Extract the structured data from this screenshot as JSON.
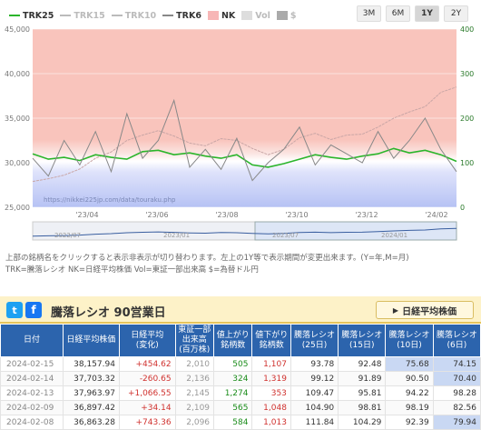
{
  "legend": {
    "items": [
      {
        "label": "TRK25",
        "color": "#2bb52b",
        "style": "line",
        "active": true
      },
      {
        "label": "TRK15",
        "color": "#bbbbbb",
        "style": "line",
        "active": false
      },
      {
        "label": "TRK10",
        "color": "#bbbbbb",
        "style": "line",
        "active": false
      },
      {
        "label": "TRK6",
        "color": "#888888",
        "style": "line",
        "active": true
      },
      {
        "label": "NK",
        "color": "#f7b6b6",
        "style": "box",
        "active": true
      },
      {
        "label": "Vol",
        "color": "#dddddd",
        "style": "box",
        "active": false
      },
      {
        "label": "$",
        "color": "#aaaaaa",
        "style": "box",
        "active": false
      }
    ]
  },
  "period_buttons": [
    {
      "label": "3M",
      "active": false
    },
    {
      "label": "6M",
      "active": false
    },
    {
      "label": "1Y",
      "active": true
    },
    {
      "label": "2Y",
      "active": false
    }
  ],
  "chart_data": {
    "type": "line",
    "left_axis": {
      "ticks": [
        "45,000",
        "40,000",
        "35,000",
        "30,000",
        "25,000"
      ],
      "range": [
        25000,
        45000
      ]
    },
    "right_axis": {
      "ticks": [
        "400",
        "300",
        "200",
        "100",
        "0"
      ],
      "range": [
        0,
        400
      ]
    },
    "x_ticks": [
      "'23/04",
      "'23/06",
      "'23/08",
      "'23/10",
      "'23/12",
      "'24/02"
    ],
    "watermark": "https://nikkei225jp.com/data/touraku.php",
    "navigator_labels": [
      "2022/07",
      "2023/01",
      "2023/07",
      "2024/01"
    ],
    "series": [
      {
        "name": "NK",
        "color": "#f7b6b6",
        "values": [
          27900,
          28200,
          28600,
          29300,
          30500,
          31200,
          32500,
          33100,
          33600,
          33000,
          32200,
          31900,
          32700,
          32500,
          31600,
          30900,
          31500,
          32800,
          33300,
          32600,
          33100,
          33200,
          34000,
          35000,
          35700,
          36300,
          37900,
          38500
        ]
      },
      {
        "name": "TRK25",
        "color": "#2bb52b",
        "values": [
          120,
          108,
          112,
          105,
          118,
          112,
          108,
          125,
          128,
          118,
          122,
          115,
          110,
          118,
          95,
          90,
          98,
          108,
          118,
          112,
          108,
          115,
          120,
          132,
          122,
          128,
          118,
          103
        ]
      },
      {
        "name": "TRK6",
        "color": "#888888",
        "values": [
          110,
          70,
          150,
          95,
          170,
          80,
          210,
          110,
          150,
          240,
          90,
          130,
          85,
          155,
          60,
          100,
          130,
          180,
          95,
          140,
          120,
          100,
          170,
          110,
          150,
          200,
          130,
          80
        ]
      }
    ]
  },
  "notes": {
    "line1": "上部の銘柄名をクリックすると表示非表示が切り替わります。左上の1Y等で表示期間が変更出来ます。(Y=年,M=月)",
    "line2": "TRK=騰落レシオ NK=日経平均株価 Vol=東証一部出来高 $=為替ドル円"
  },
  "ratio": {
    "social_tw": "t",
    "social_fb": "f",
    "title": "騰落レシオ 90営業日",
    "avg_button": "日経平均株価",
    "headers": [
      "日付",
      "日経平均株価",
      "日経平均\n(変化)",
      "東証一部\n出来高\n(百万株)",
      "値上がり\n銘柄数",
      "値下がり\n銘柄数",
      "騰落レシオ\n(25日)",
      "騰落レシオ\n(15日)",
      "騰落レシオ\n(10日)",
      "騰落レシオ\n(6日)"
    ],
    "rows": [
      [
        "2024-02-15",
        "38,157.94",
        "+454.62",
        "2,010",
        "505",
        "1,107",
        "93.78",
        "92.48",
        "75.68",
        "74.15"
      ],
      [
        "2024-02-14",
        "37,703.32",
        "-260.65",
        "2,136",
        "324",
        "1,319",
        "99.12",
        "91.89",
        "90.50",
        "70.40"
      ],
      [
        "2024-02-13",
        "37,963.97",
        "+1,066.55",
        "2,145",
        "1,274",
        "353",
        "109.47",
        "95.81",
        "94.22",
        "98.28"
      ],
      [
        "2024-02-09",
        "36,897.42",
        "+34.14",
        "2,109",
        "565",
        "1,048",
        "104.90",
        "98.81",
        "98.19",
        "82.56"
      ],
      [
        "2024-02-08",
        "36,863.28",
        "+743.36",
        "2,096",
        "584",
        "1,013",
        "111.84",
        "104.29",
        "92.39",
        "79.94"
      ]
    ]
  }
}
